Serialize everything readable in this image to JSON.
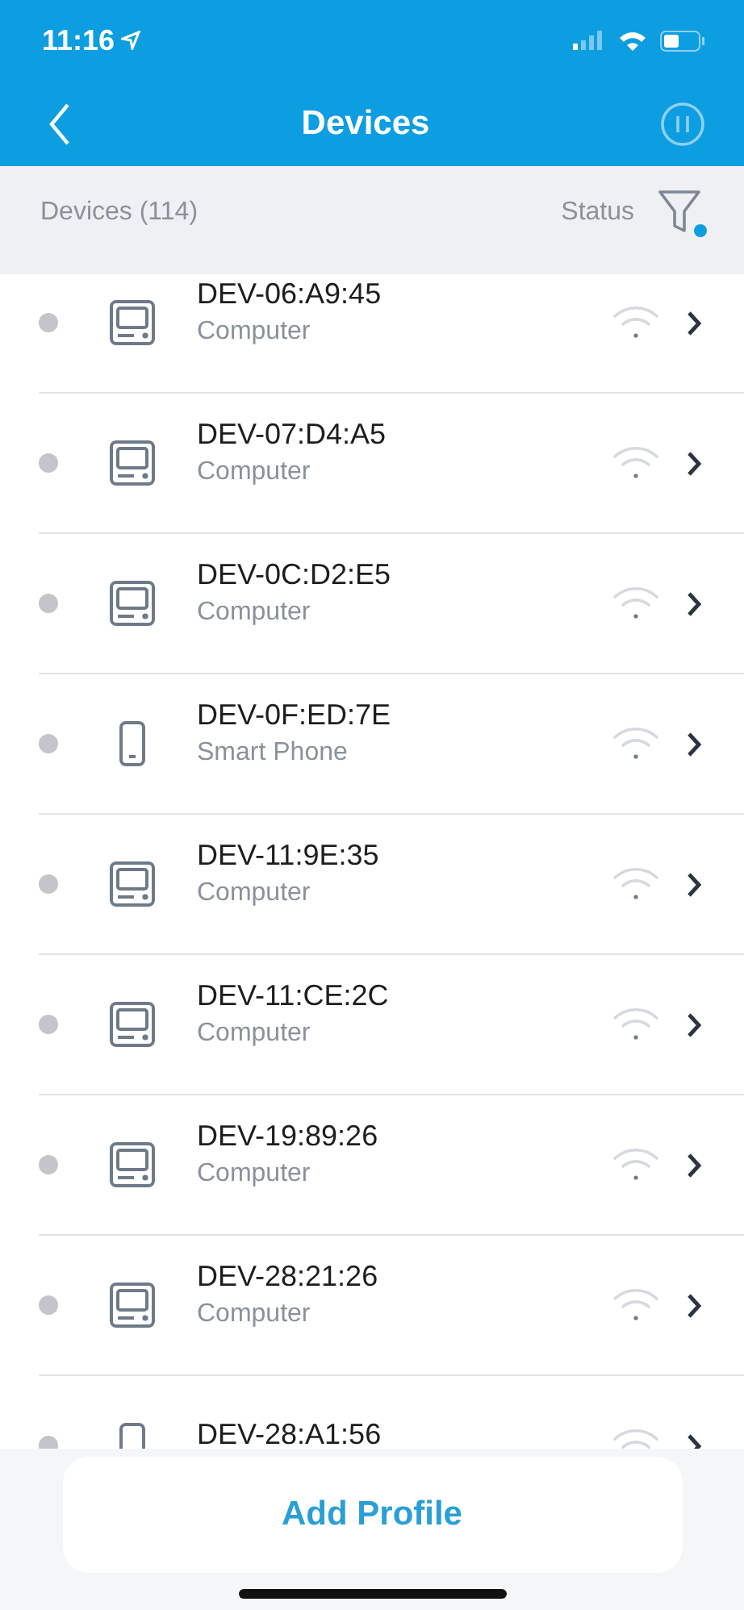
{
  "status_bar": {
    "time": "11:16"
  },
  "nav": {
    "title": "Devices"
  },
  "subheader": {
    "count_label": "Devices (114)",
    "sort_label": "Status",
    "filter_active": true
  },
  "devices": [
    {
      "name": "DEV-06:A9:45",
      "type": "Computer",
      "kind": "computer",
      "online": false
    },
    {
      "name": "DEV-07:D4:A5",
      "type": "Computer",
      "kind": "computer",
      "online": false
    },
    {
      "name": "DEV-0C:D2:E5",
      "type": "Computer",
      "kind": "computer",
      "online": false
    },
    {
      "name": "DEV-0F:ED:7E",
      "type": "Smart Phone",
      "kind": "phone",
      "online": false
    },
    {
      "name": "DEV-11:9E:35",
      "type": "Computer",
      "kind": "computer",
      "online": false
    },
    {
      "name": "DEV-11:CE:2C",
      "type": "Computer",
      "kind": "computer",
      "online": false
    },
    {
      "name": "DEV-19:89:26",
      "type": "Computer",
      "kind": "computer",
      "online": false
    },
    {
      "name": "DEV-28:21:26",
      "type": "Computer",
      "kind": "computer",
      "online": false
    },
    {
      "name": "DEV-28:A1:56",
      "kind": "phone",
      "online": false
    }
  ],
  "footer": {
    "button": "Add Profile"
  }
}
